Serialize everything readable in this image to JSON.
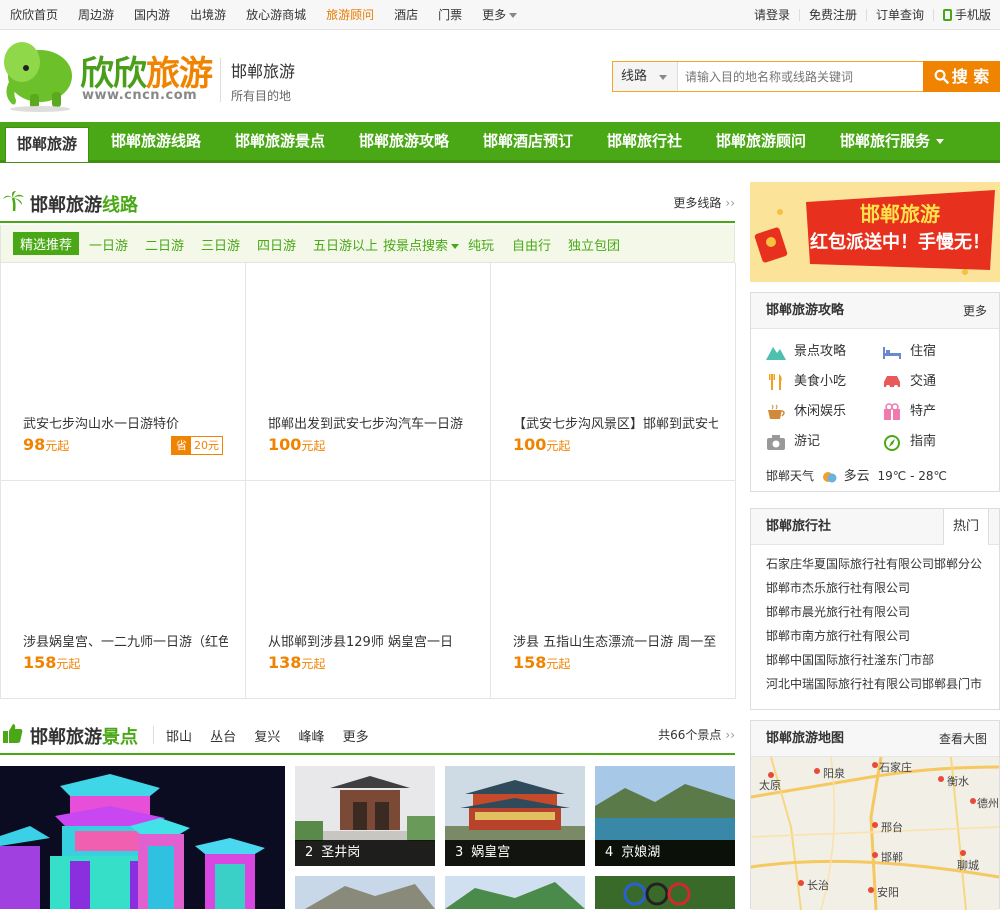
{
  "topbar": {
    "links": [
      "欣欣首页",
      "周边游",
      "国内游",
      "出境游",
      "放心游商城",
      "旅游顾问",
      "酒店",
      "门票",
      "更多"
    ],
    "login": "请登录",
    "register": "免费注册",
    "orders": "订单查询",
    "mobile": "手机版"
  },
  "logo": {
    "brand_a": "欣欣",
    "brand_b": "旅游",
    "url": "www.cncn.com"
  },
  "city": {
    "title": "邯郸旅游",
    "subtitle": "所有目的地"
  },
  "search": {
    "type": "线路",
    "placeholder": "请输入目的地名称或线路关键词",
    "button": "搜 索"
  },
  "nav": [
    "邯郸旅游",
    "邯郸旅游线路",
    "邯郸旅游景点",
    "邯郸旅游攻略",
    "邯郸酒店预订",
    "邯郸旅行社",
    "邯郸旅游顾问",
    "邯郸旅行服务"
  ],
  "routes": {
    "title_a": "邯郸旅游",
    "title_b": "线路",
    "more": "更多线路",
    "tabs": [
      "精选推荐",
      "一日游",
      "二日游",
      "三日游",
      "四日游",
      "五日游以上",
      "按景点搜索",
      "纯玩",
      "自由行",
      "独立包团"
    ],
    "items": [
      {
        "title": "武安七步沟山水一日游特价",
        "price": "98",
        "unit": "元起",
        "save_a": "省",
        "save_b": "20元"
      },
      {
        "title": "邯郸出发到武安七步沟汽车一日游",
        "price": "100",
        "unit": "元起"
      },
      {
        "title": "【武安七步沟风景区】邯郸到武安七",
        "price": "100",
        "unit": "元起"
      },
      {
        "title": "涉县娲皇宫、一二九师一日游（红色",
        "price": "158",
        "unit": "元起"
      },
      {
        "title": "从邯郸到涉县129师 娲皇宫一日",
        "price": "138",
        "unit": "元起"
      },
      {
        "title": "涉县 五指山生态漂流一日游 周一至",
        "price": "158",
        "unit": "元起"
      }
    ]
  },
  "scenic": {
    "title_a": "邯郸旅游",
    "title_b": "景点",
    "tags": [
      "邯山",
      "丛台",
      "复兴",
      "峰峰",
      "更多"
    ],
    "count": "共66个景点",
    "spots": [
      {
        "num": "2",
        "name": "圣井岗"
      },
      {
        "num": "3",
        "name": "娲皇宫"
      },
      {
        "num": "4",
        "name": "京娘湖"
      }
    ]
  },
  "banner": {
    "line1": "邯郸旅游",
    "line2": "红包派送中！手慢无！"
  },
  "guide": {
    "title": "邯郸旅游攻略",
    "more": "更多",
    "items": [
      "景点攻略",
      "住宿",
      "美食小吃",
      "交通",
      "休闲娱乐",
      "特产",
      "游记",
      "指南"
    ],
    "weather_label": "邯郸天气",
    "weather": "多云",
    "temp": "19℃ - 28℃"
  },
  "agency": {
    "title": "邯郸旅行社",
    "tab": "热门",
    "list": [
      "石家庄华夏国际旅行社有限公司邯郸分公",
      "邯郸市杰乐旅行社有限公司",
      "邯郸市晨光旅行社有限公司",
      "邯郸市南方旅行社有限公司",
      "邯郸中国国际旅行社滏东门市部",
      "河北中瑞国际旅行社有限公司邯郸县门市"
    ]
  },
  "map": {
    "title": "邯郸旅游地图",
    "more": "查看大图",
    "cities": [
      "石家庄",
      "衡水",
      "太原",
      "阳泉",
      "德州",
      "邢台",
      "邯郸",
      "聊城",
      "长治",
      "安阳"
    ]
  },
  "colors": {
    "green": "#4aa816",
    "orange": "#f08300"
  }
}
